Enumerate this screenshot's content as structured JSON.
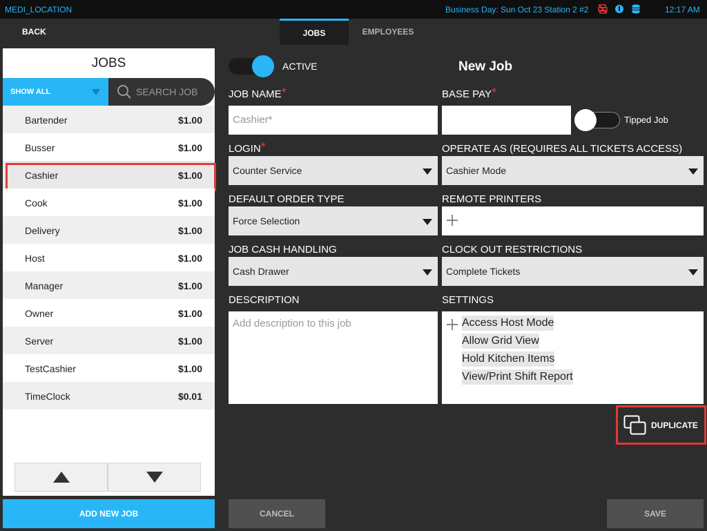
{
  "status_bar": {
    "location": "MEDI_LOCATION",
    "business_day": "Business Day: Sun Oct 23  Station 2  #2",
    "time": "12:17 AM",
    "icons": [
      "printer-offline-icon",
      "info-icon",
      "database-icon"
    ]
  },
  "nav": {
    "back_label": "BACK",
    "tabs": [
      {
        "label": "JOBS",
        "active": true
      },
      {
        "label": "EMPLOYEES",
        "active": false
      }
    ]
  },
  "jobs_panel": {
    "title": "JOBS",
    "filter_label": "SHOW ALL",
    "search_placeholder": "SEARCH JOB",
    "jobs": [
      {
        "name": "Bartender",
        "pay": "$1.00"
      },
      {
        "name": "Busser",
        "pay": "$1.00"
      },
      {
        "name": "Cashier",
        "pay": "$1.00",
        "selected": true
      },
      {
        "name": "Cook",
        "pay": "$1.00"
      },
      {
        "name": "Delivery",
        "pay": "$1.00"
      },
      {
        "name": "Host",
        "pay": "$1.00"
      },
      {
        "name": "Manager",
        "pay": "$1.00"
      },
      {
        "name": "Owner",
        "pay": "$1.00"
      },
      {
        "name": "Server",
        "pay": "$1.00"
      },
      {
        "name": "TestCashier",
        "pay": "$1.00"
      },
      {
        "name": "TimeClock",
        "pay": "$0.01"
      }
    ],
    "add_new_label": "ADD NEW JOB"
  },
  "form": {
    "active_label": "ACTIVE",
    "active_on": true,
    "title": "New Job",
    "job_name_label": "JOB NAME",
    "job_name_placeholder": "Cashier*",
    "base_pay_label": "BASE PAY",
    "base_pay_value": "",
    "tipped_label": "Tipped Job",
    "tipped_on": false,
    "login_label": "LOGIN",
    "login_value": "Counter Service",
    "operate_as_label": "OPERATE AS (REQUIRES ALL TICKETS ACCESS)",
    "operate_as_value": "Cashier Mode",
    "default_order_type_label": "DEFAULT ORDER TYPE",
    "default_order_type_value": "Force Selection",
    "remote_printers_label": "REMOTE PRINTERS",
    "cash_handling_label": "JOB CASH HANDLING",
    "cash_handling_value": "Cash Drawer",
    "clock_out_label": "CLOCK OUT RESTRICTIONS",
    "clock_out_value": "Complete Tickets",
    "description_label": "DESCRIPTION",
    "description_placeholder": "Add description to this job",
    "settings_label": "SETTINGS",
    "settings": [
      "Access Host Mode",
      "Allow Grid View",
      "Hold Kitchen Items",
      "View/Print Shift Report"
    ],
    "duplicate_label": "DUPLICATE",
    "cancel_label": "CANCEL",
    "save_label": "SAVE",
    "required_marker": "*"
  },
  "colors": {
    "accent": "#29b6f6",
    "highlight": "#e53935",
    "background": "#2d2d2d"
  }
}
